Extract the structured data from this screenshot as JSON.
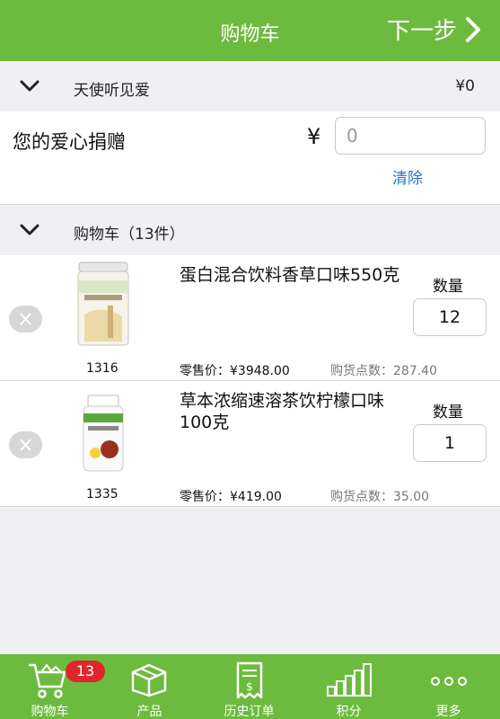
{
  "header": {
    "title": "购物车",
    "next_label": "下一步"
  },
  "donation_section": {
    "label": "天使听见爱",
    "amount": "¥0"
  },
  "donation": {
    "label": "您的爱心捐赠",
    "currency": "¥",
    "value": "0",
    "clear_label": "清除"
  },
  "cart_section": {
    "label": "购物车（13件）"
  },
  "items": [
    {
      "code": "1316",
      "name": "蛋白混合饮料香草口味550克",
      "qty_label": "数量",
      "qty": "12",
      "price": "零售价：¥3948.00",
      "points": "购货点数：287.40"
    },
    {
      "code": "1335",
      "name": "草本浓缩速溶茶饮柠檬口味 100克",
      "qty_label": "数量",
      "qty": "1",
      "price": "零售价：¥419.00",
      "points": "购货点数：35.00"
    }
  ],
  "tabbar": {
    "badge": "13",
    "tabs": [
      {
        "label": "购物车",
        "icon": "cart-icon"
      },
      {
        "label": "产品",
        "icon": "box-icon"
      },
      {
        "label": "历史订单",
        "icon": "receipt-icon"
      },
      {
        "label": "积分",
        "icon": "bar-chart-icon"
      },
      {
        "label": "更多",
        "icon": "more-icon"
      }
    ]
  },
  "colors": {
    "brand_green": "#6dbb3e",
    "badge_red": "#e0262a",
    "link_blue": "#2a78c4"
  }
}
